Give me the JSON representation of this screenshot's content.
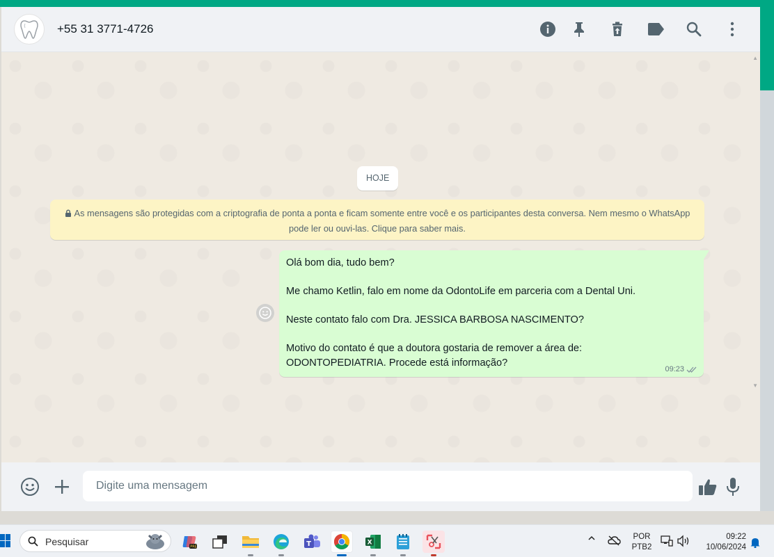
{
  "header": {
    "contact": "+55 31 3771-4726",
    "icons": [
      "info-icon",
      "pin-icon",
      "delete-icon",
      "label-icon",
      "search-icon",
      "menu-icon"
    ]
  },
  "chat": {
    "date_label": "HOJE",
    "encryption_notice": "As mensagens são protegidas com a criptografia de ponta a ponta e ficam somente entre você e os participantes desta conversa. Nem mesmo o WhatsApp pode ler ou ouvi-las. Clique para saber mais.",
    "message": {
      "lines": [
        "Olá bom dia, tudo bem?",
        "Me chamo Ketlin, falo em nome da OdontoLife em parceria com a Dental Uni.",
        "Neste contato falo com Dra. JESSICA BARBOSA NASCIMENTO?",
        "Motivo do contato é que a doutora gostaria de remover a área de:",
        "ODONTOPEDIATRIA. Procede está informação?"
      ],
      "time": "09:23",
      "status": "read-double-check"
    }
  },
  "composer": {
    "placeholder": "Digite uma mensagem"
  },
  "taskbar": {
    "search_label": "Pesquisar",
    "language_line1": "POR",
    "language_line2": "PTB2",
    "clock_time": "09:22",
    "clock_date": "10/06/2024"
  },
  "colors": {
    "accent": "#00a884",
    "outgoing_bubble": "#d9fdd3",
    "notice_bg": "#fdf4c5",
    "read_tick": "#8696a0"
  }
}
